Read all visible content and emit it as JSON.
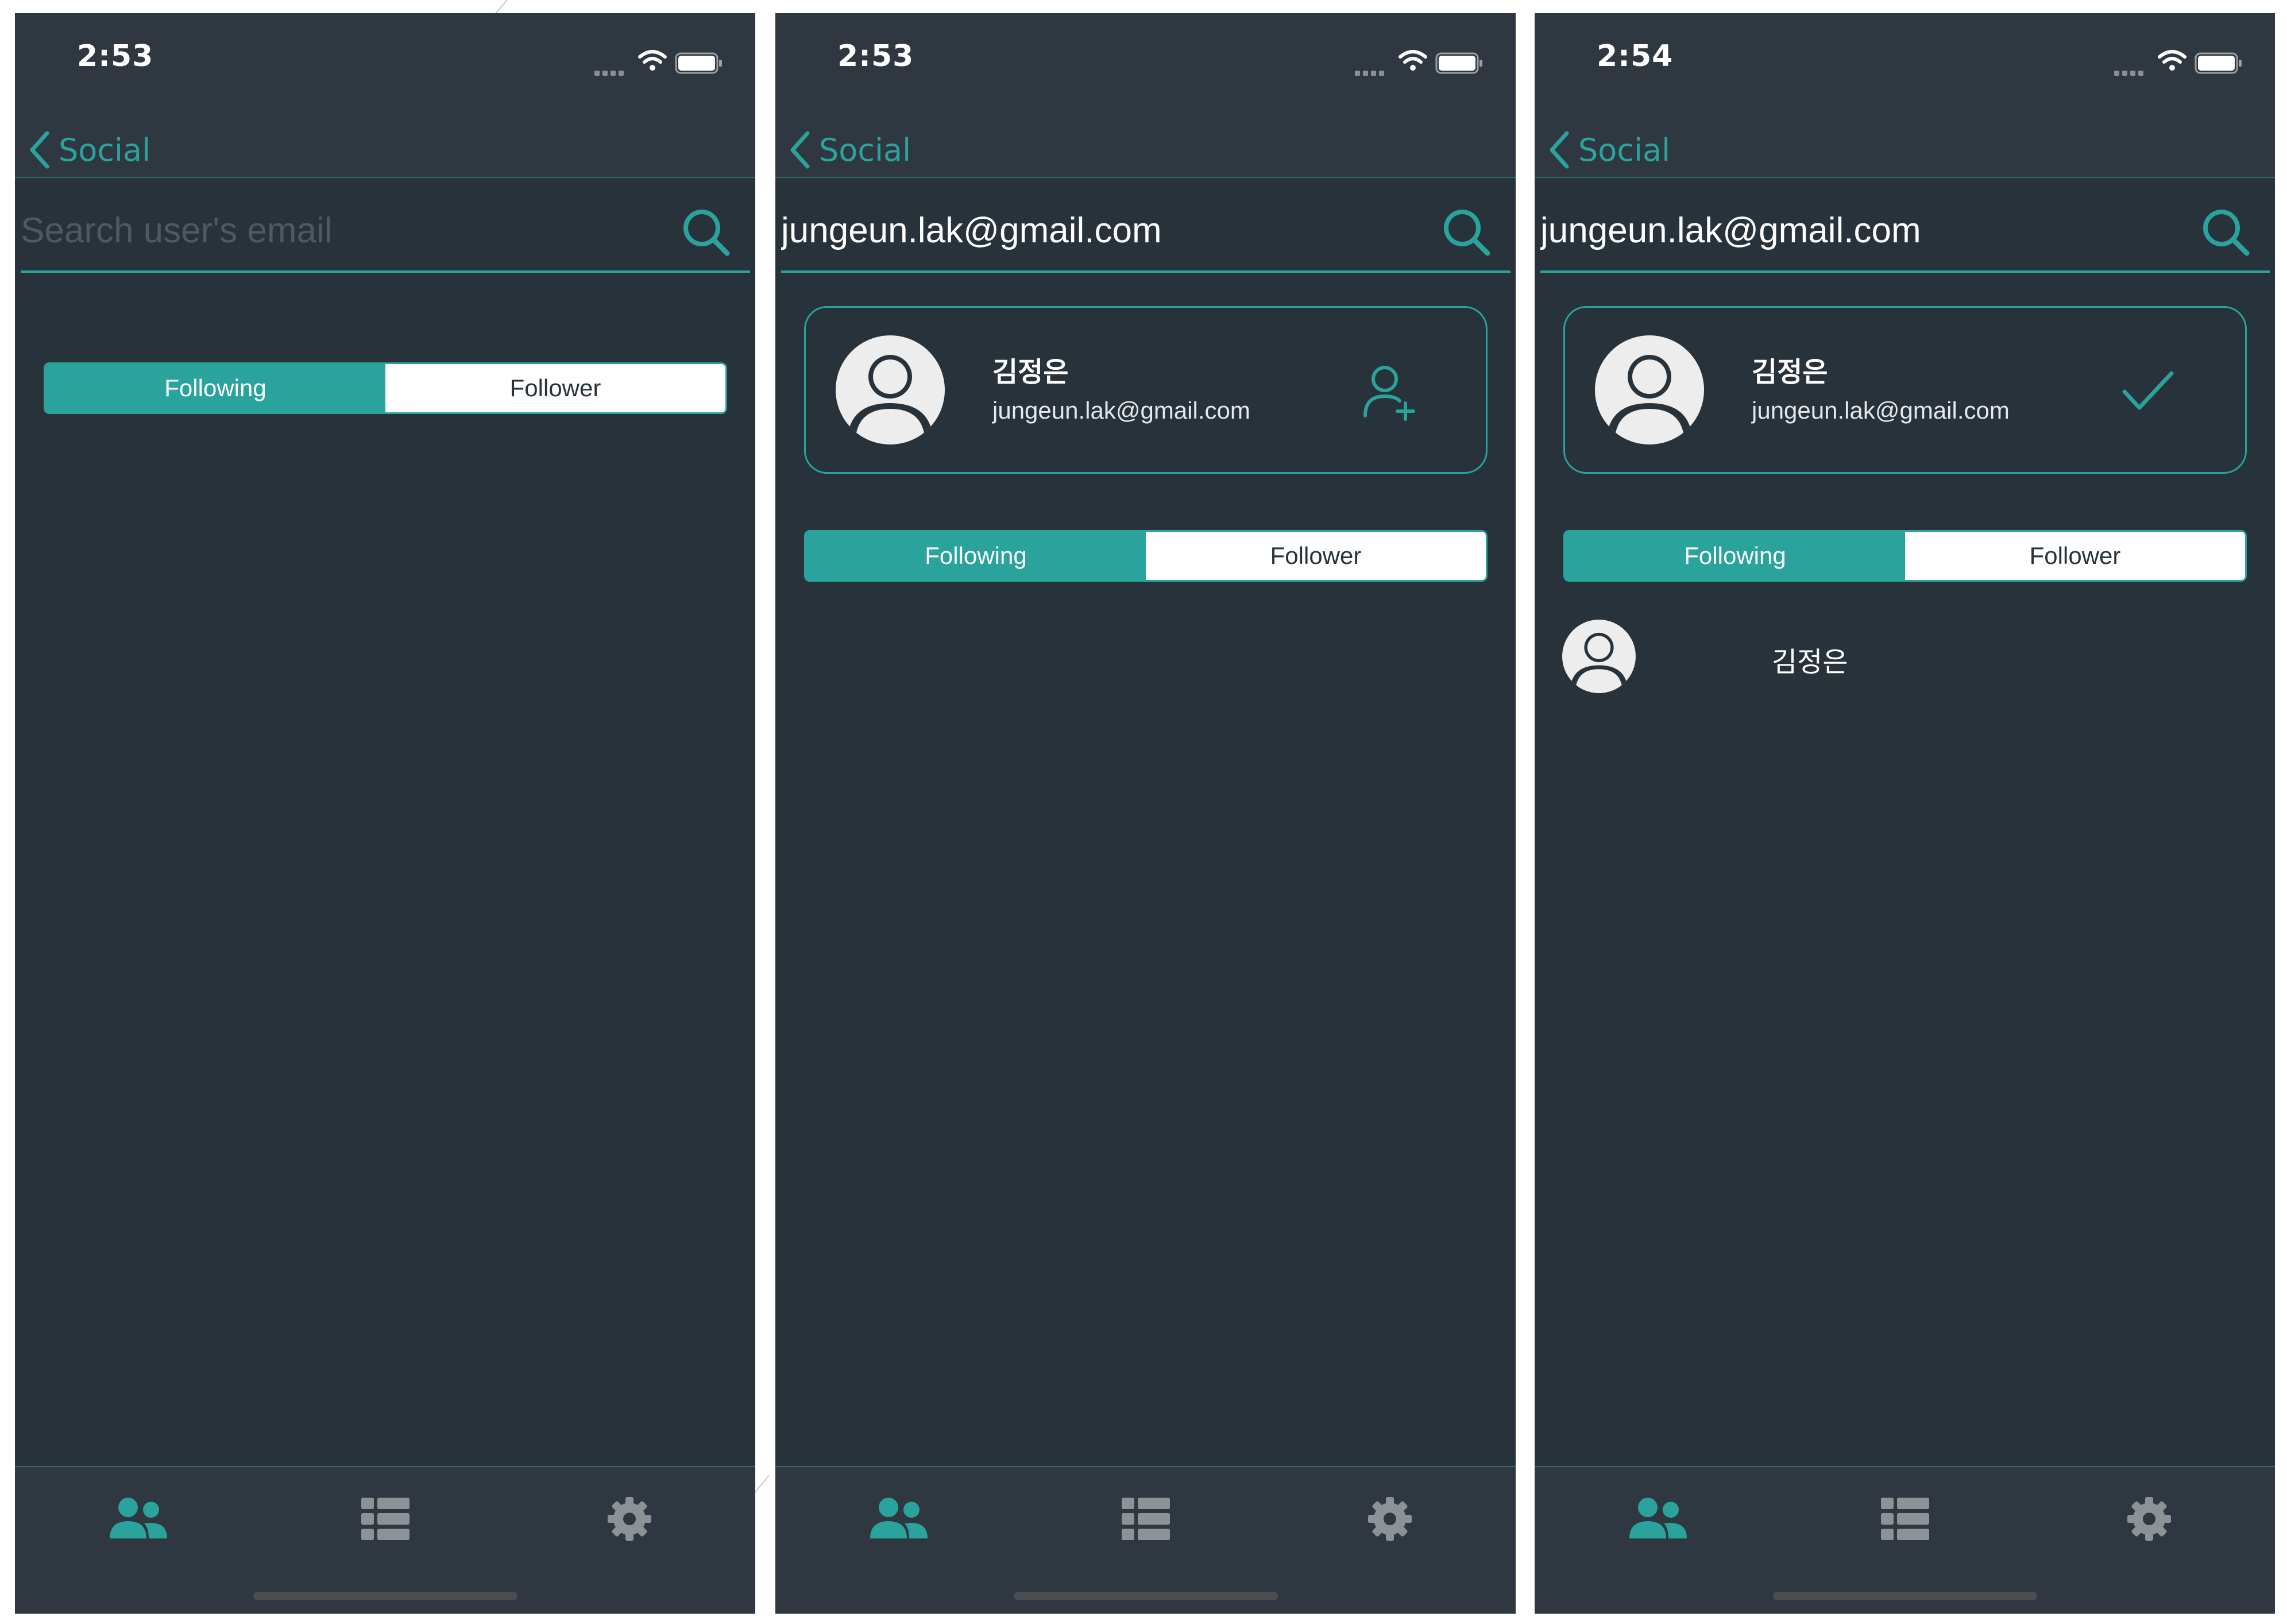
{
  "colors": {
    "accent": "#2aa39d",
    "background": "#27323b",
    "bar": "#2f3841",
    "inactive_icon": "#8d9297"
  },
  "screens": [
    {
      "status": {
        "time": "2:53"
      },
      "nav": {
        "back_label": "Social"
      },
      "search": {
        "placeholder": "Search user's email",
        "value": ""
      },
      "segments": {
        "following": "Following",
        "follower": "Follower",
        "selected": "Following"
      },
      "tabs": [
        {
          "icon": "people-icon",
          "active": true
        },
        {
          "icon": "list-icon",
          "active": false
        },
        {
          "icon": "gear-icon",
          "active": false
        }
      ]
    },
    {
      "status": {
        "time": "2:53"
      },
      "nav": {
        "back_label": "Social"
      },
      "search": {
        "placeholder": "Search user's email",
        "value": "jungeun.lak@gmail.com"
      },
      "result": {
        "name": "김정은",
        "email": "jungeun.lak@gmail.com",
        "action_icon": "add-user-icon"
      },
      "segments": {
        "following": "Following",
        "follower": "Follower",
        "selected": "Following"
      },
      "tabs": [
        {
          "icon": "people-icon",
          "active": true
        },
        {
          "icon": "list-icon",
          "active": false
        },
        {
          "icon": "gear-icon",
          "active": false
        }
      ]
    },
    {
      "status": {
        "time": "2:54"
      },
      "nav": {
        "back_label": "Social"
      },
      "search": {
        "placeholder": "Search user's email",
        "value": "jungeun.lak@gmail.com"
      },
      "result": {
        "name": "김정은",
        "email": "jungeun.lak@gmail.com",
        "action_icon": "checkmark-icon"
      },
      "segments": {
        "following": "Following",
        "follower": "Follower",
        "selected": "Following"
      },
      "following_list": [
        {
          "name": "김정은"
        }
      ],
      "tabs": [
        {
          "icon": "people-icon",
          "active": true
        },
        {
          "icon": "list-icon",
          "active": false
        },
        {
          "icon": "gear-icon",
          "active": false
        }
      ]
    }
  ]
}
